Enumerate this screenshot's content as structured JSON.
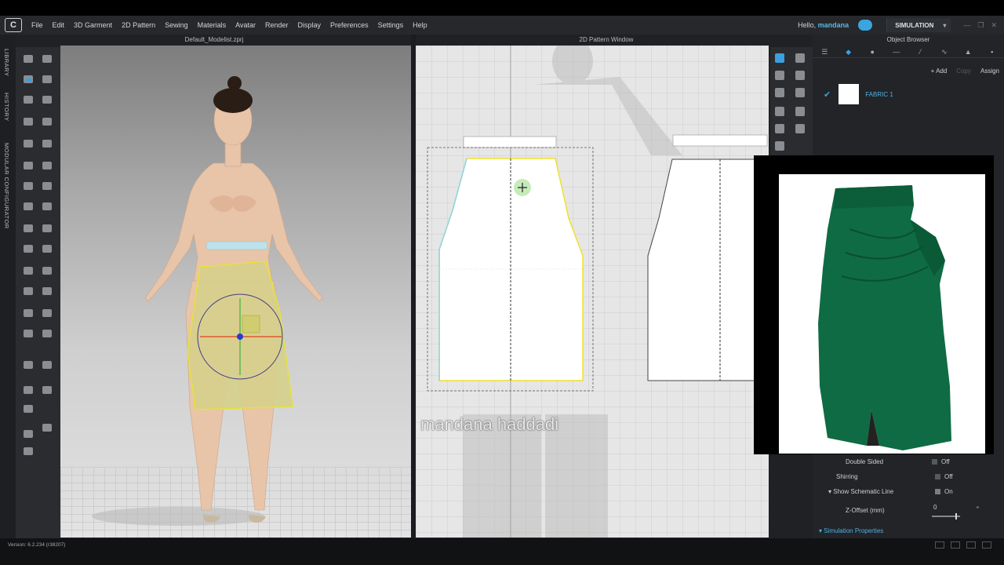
{
  "menu": {
    "logo": "C",
    "items": [
      "File",
      "Edit",
      "3D Garment",
      "2D Pattern",
      "Sewing",
      "Materials",
      "Avatar",
      "Render",
      "Display",
      "Preferences",
      "Settings",
      "Help"
    ],
    "hello_prefix": "Hello,",
    "username": "mandana",
    "simulation_label": "SIMULATION"
  },
  "left_tabs": {
    "library": "LIBRARY",
    "history": "HISTORY",
    "modular": "MODULAR CONFIGURATOR"
  },
  "panels": {
    "viewport3d_title": "Default_Modelist.zprj",
    "viewport2d_title": "2D Pattern Window",
    "object_browser_title": "Object Browser"
  },
  "watermark": "mandana haddadi",
  "object_browser": {
    "add": "+ Add",
    "copy": "Copy",
    "assign": "Assign",
    "fabric_name": "FABRIC 1"
  },
  "properties": {
    "double_sided": {
      "label": "Double Sided",
      "value": "Off"
    },
    "shirring": {
      "label": "Shirring",
      "value": "Off"
    },
    "schematic": {
      "label": "▾ Show Schematic Line",
      "value": "On"
    },
    "z_offset": {
      "label": "Z-Offset (mm)",
      "value": "0"
    },
    "simulation_properties": "▾ Simulation Properties"
  },
  "status": {
    "version": "Version: 6.2.234 (r38207)"
  },
  "colors": {
    "accent": "#3aa0e0",
    "skirt_3d": "#d5d08a",
    "skirt_ref": "#0f6b43"
  }
}
